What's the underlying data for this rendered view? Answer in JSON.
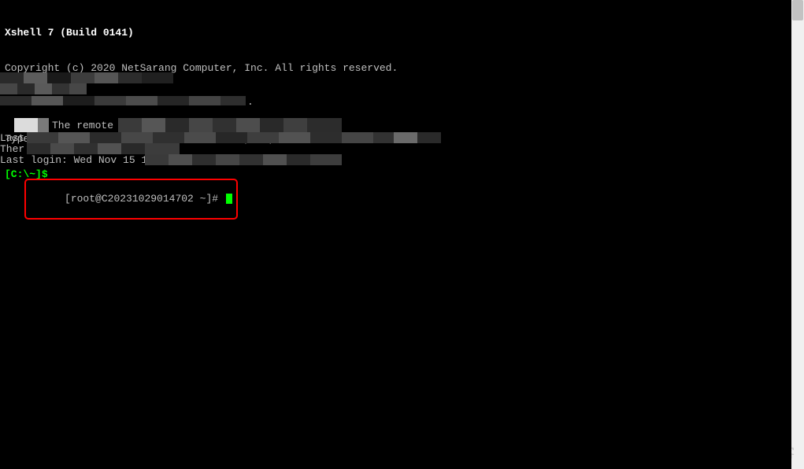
{
  "header": {
    "title": "Xshell 7 (Build 0141)",
    "copyright": "Copyright (c) 2020 NetSarang Computer, Inc. All rights reserved."
  },
  "help_line": "Type `help' to learn how to use Xshell prompt.",
  "local_prompt": {
    "path": "[C:\\~]",
    "symbol": "$"
  },
  "obscured": {
    "dot": ".",
    "frag_remote": "The remote S",
    "frag_last": "Last",
    "frag_ther": "Ther",
    "frag_last_login": "Last login: Wed Nov 15 15:"
  },
  "shell_prompt": {
    "full": "[root@C20231029014702 ~]# "
  },
  "watermark": "@51CTO博客"
}
